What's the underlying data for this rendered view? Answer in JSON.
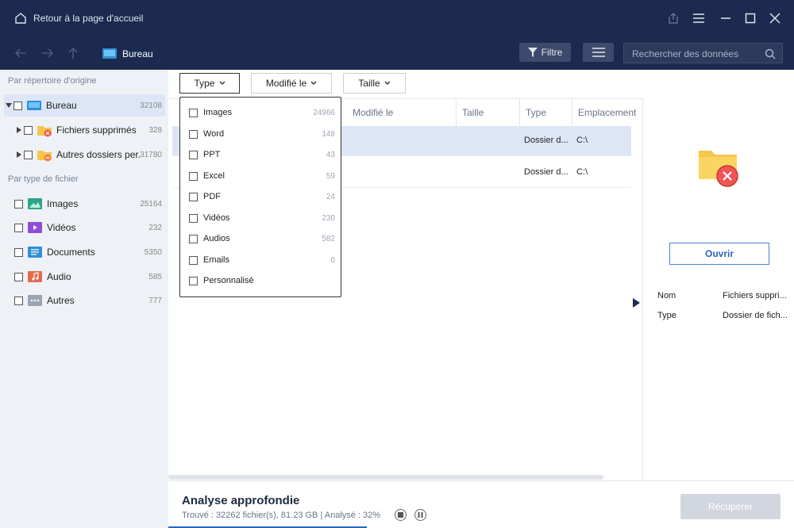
{
  "window": {
    "title": "Retour à la page d'accueil",
    "icons": [
      "home-icon",
      "export-icon",
      "hamburger-icon",
      "minimize-icon",
      "maximize-icon",
      "close-icon"
    ]
  },
  "toolbar": {
    "breadcrumb": "Bureau",
    "filter_label": "Filtre",
    "search_placeholder": "Rechercher des données"
  },
  "sidebar": {
    "origin_heading": "Par répertoire d'origine",
    "tree": [
      {
        "label": "Bureau",
        "count": "32108",
        "selected": true
      },
      {
        "label": "Fichiers supprimés",
        "count": "328"
      },
      {
        "label": "Autres dossiers per...",
        "count": "31780"
      }
    ],
    "type_heading": "Par type de fichier",
    "types": [
      {
        "label": "Images",
        "count": "25164",
        "color": "#2ea58a"
      },
      {
        "label": "Vidéos",
        "count": "232",
        "color": "#8e4fd6"
      },
      {
        "label": "Documents",
        "count": "5350",
        "color": "#2f8fd8"
      },
      {
        "label": "Audio",
        "count": "585",
        "color": "#e36b4a"
      },
      {
        "label": "Autres",
        "count": "777",
        "color": "#9aa3b2"
      }
    ]
  },
  "filters": {
    "type": "Type",
    "modified": "Modifié le",
    "size": "Taille"
  },
  "dropdown": {
    "items": [
      {
        "label": "Images",
        "count": "24966"
      },
      {
        "label": "Word",
        "count": "148"
      },
      {
        "label": "PPT",
        "count": "43"
      },
      {
        "label": "Excel",
        "count": "59"
      },
      {
        "label": "PDF",
        "count": "24"
      },
      {
        "label": "Vidéos",
        "count": "230"
      },
      {
        "label": "Audios",
        "count": "582"
      },
      {
        "label": "Emails",
        "count": "0"
      },
      {
        "label": "Personnalisé",
        "count": ""
      }
    ]
  },
  "list": {
    "columns": {
      "modified": "Modifié le",
      "size": "Taille",
      "type": "Type",
      "location": "Emplacement"
    },
    "rows": [
      {
        "type": "Dossier d...",
        "location": "C:\\",
        "selected": true
      },
      {
        "type": "Dossier d...",
        "location": "C:\\"
      }
    ]
  },
  "detail": {
    "open_label": "Ouvrir",
    "name_key": "Nom",
    "name_value": "Fichiers suppri...",
    "type_key": "Type",
    "type_value": "Dossier de fich..."
  },
  "status": {
    "title": "Analyse approfondie",
    "summary": "Trouvé : 32262 fichier(s), 81.23 GB | Analysé : 32%",
    "progress_percent": 32,
    "recover_label": "Récupérer"
  }
}
